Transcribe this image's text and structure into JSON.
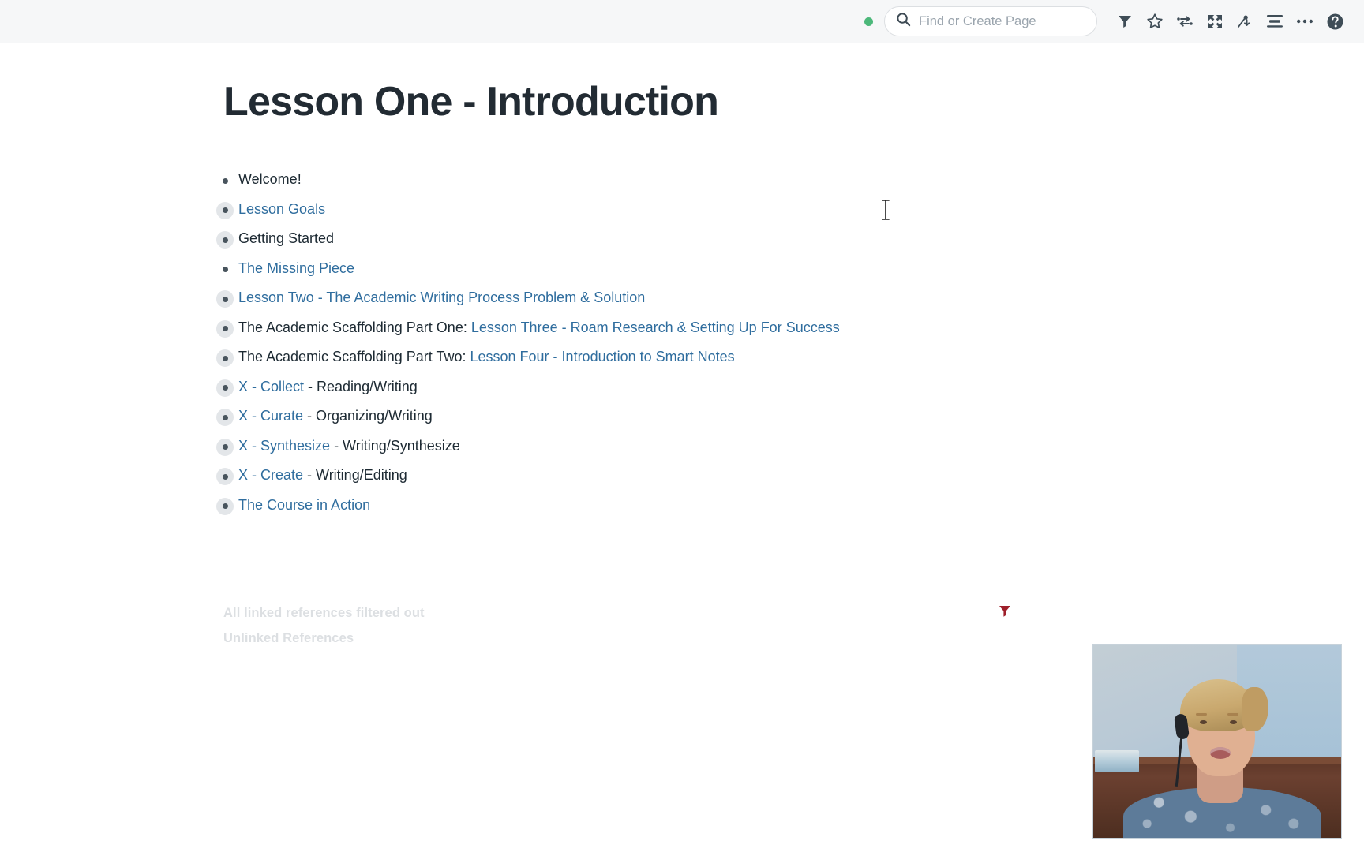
{
  "topbar": {
    "status_dot_color": "#4cb87a",
    "status_dot_name": "connection-status-dot",
    "search": {
      "placeholder": "Find or Create Page",
      "value": ""
    },
    "icons": [
      {
        "name": "filter-icon",
        "label": "Filter"
      },
      {
        "name": "star-icon",
        "label": "Star page"
      },
      {
        "name": "shortcuts-icon",
        "label": "Shortcuts"
      },
      {
        "name": "expand-icon",
        "label": "Fullscreen"
      },
      {
        "name": "graph-overview-icon",
        "label": "Graph overview"
      },
      {
        "name": "sidebar-toggle-icon",
        "label": "Toggle right sidebar"
      },
      {
        "name": "more-options-icon",
        "label": "More options"
      },
      {
        "name": "help-icon",
        "label": "Help"
      }
    ]
  },
  "page": {
    "title": "Lesson One - Introduction",
    "blocks": [
      {
        "bullet": "plain",
        "segments": [
          {
            "text": "Welcome!",
            "style": "plain"
          }
        ]
      },
      {
        "bullet": "halo",
        "segments": [
          {
            "text": "Lesson Goals",
            "style": "link"
          }
        ]
      },
      {
        "bullet": "halo",
        "segments": [
          {
            "text": "Getting Started",
            "style": "plain"
          }
        ]
      },
      {
        "bullet": "plain",
        "segments": [
          {
            "text": "The Missing Piece",
            "style": "link"
          }
        ]
      },
      {
        "bullet": "halo",
        "segments": [
          {
            "text": "Lesson Two - The Academic Writing Process Problem & Solution",
            "style": "link"
          }
        ]
      },
      {
        "bullet": "halo",
        "segments": [
          {
            "text": "The Academic Scaffolding Part One: ",
            "style": "plain"
          },
          {
            "text": "Lesson Three - Roam Research & Setting Up For Success",
            "style": "link"
          }
        ]
      },
      {
        "bullet": "halo",
        "segments": [
          {
            "text": "The Academic Scaffolding Part Two: ",
            "style": "plain"
          },
          {
            "text": "Lesson Four - Introduction to Smart Notes",
            "style": "link"
          }
        ]
      },
      {
        "bullet": "halo",
        "segments": [
          {
            "text": "X - Collect",
            "style": "link"
          },
          {
            "text": " - Reading/Writing",
            "style": "plain"
          }
        ]
      },
      {
        "bullet": "halo",
        "segments": [
          {
            "text": "X - Curate",
            "style": "link"
          },
          {
            "text": " - Organizing/Writing",
            "style": "plain"
          }
        ]
      },
      {
        "bullet": "halo",
        "segments": [
          {
            "text": "X - Synthesize",
            "style": "link"
          },
          {
            "text": " - Writing/Synthesize",
            "style": "plain"
          }
        ]
      },
      {
        "bullet": "halo",
        "segments": [
          {
            "text": "X - Create",
            "style": "link"
          },
          {
            "text": " - Writing/Editing",
            "style": "plain"
          }
        ]
      },
      {
        "bullet": "halo",
        "segments": [
          {
            "text": "The Course in Action",
            "style": "link"
          }
        ]
      }
    ]
  },
  "references": {
    "linked_label": "All linked references filtered out",
    "unlinked_label": "Unlinked References",
    "filter_icon_name": "linked-references-filter-icon",
    "filter_icon_color": "#9e1f2b"
  },
  "colors": {
    "link": "#2f6d9e",
    "text": "#1d2a33",
    "topbar_bg": "#f6f7f8",
    "muted": "#dcdfe2"
  }
}
